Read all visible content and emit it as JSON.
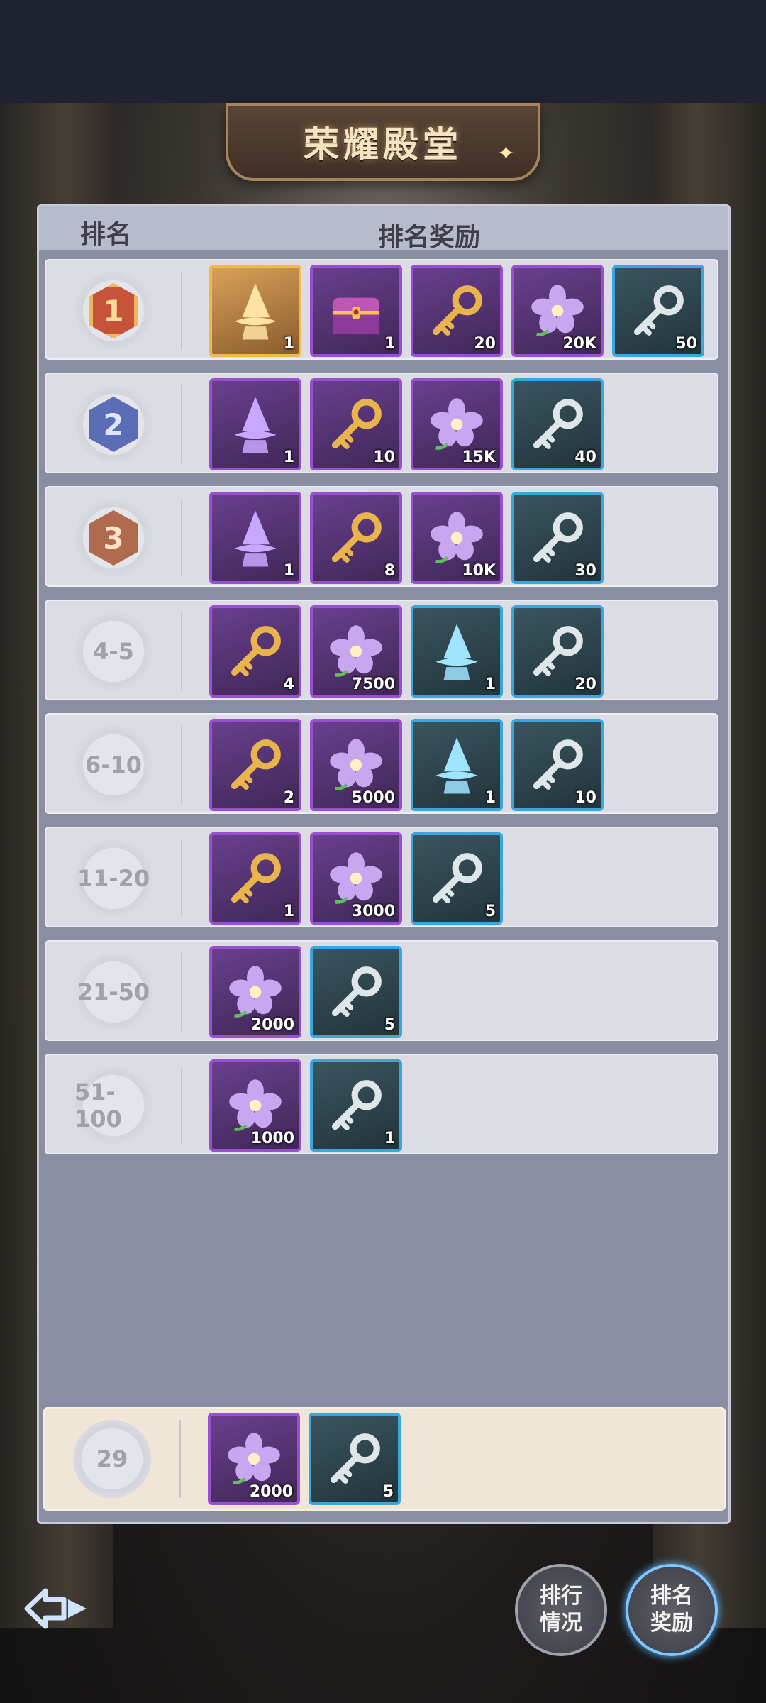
{
  "title": "荣耀殿堂",
  "header": {
    "rank": "排名",
    "reward": "排名奖励"
  },
  "rows": [
    {
      "rank": "1",
      "medal": "m1",
      "items": [
        {
          "icon": "wizard-hat-icon",
          "style": "gold",
          "qty": "1"
        },
        {
          "icon": "treasure-chest-icon",
          "style": "purple",
          "qty": "1"
        },
        {
          "icon": "gold-key-icon",
          "style": "purple",
          "qty": "20"
        },
        {
          "icon": "purple-flower-icon",
          "style": "purple",
          "qty": "20K"
        },
        {
          "icon": "silver-key-icon",
          "style": "blue",
          "qty": "50"
        }
      ]
    },
    {
      "rank": "2",
      "medal": "m2",
      "items": [
        {
          "icon": "wizard-hat-icon",
          "style": "purple",
          "qty": "1"
        },
        {
          "icon": "gold-key-icon",
          "style": "purple",
          "qty": "10"
        },
        {
          "icon": "purple-flower-icon",
          "style": "purple",
          "qty": "15K"
        },
        {
          "icon": "silver-key-icon",
          "style": "blue",
          "qty": "40"
        }
      ]
    },
    {
      "rank": "3",
      "medal": "m3",
      "items": [
        {
          "icon": "wizard-hat-icon",
          "style": "purple",
          "qty": "1"
        },
        {
          "icon": "gold-key-icon",
          "style": "purple",
          "qty": "8"
        },
        {
          "icon": "purple-flower-icon",
          "style": "purple",
          "qty": "10K"
        },
        {
          "icon": "silver-key-icon",
          "style": "blue",
          "qty": "30"
        }
      ]
    },
    {
      "rank": "4-5",
      "items": [
        {
          "icon": "gold-key-icon",
          "style": "purple",
          "qty": "4"
        },
        {
          "icon": "purple-flower-icon",
          "style": "purple",
          "qty": "7500"
        },
        {
          "icon": "wizard-hat-icon",
          "style": "blue",
          "qty": "1"
        },
        {
          "icon": "silver-key-icon",
          "style": "blue",
          "qty": "20"
        }
      ]
    },
    {
      "rank": "6-10",
      "items": [
        {
          "icon": "gold-key-icon",
          "style": "purple",
          "qty": "2"
        },
        {
          "icon": "purple-flower-icon",
          "style": "purple",
          "qty": "5000"
        },
        {
          "icon": "wizard-hat-icon",
          "style": "blue",
          "qty": "1"
        },
        {
          "icon": "silver-key-icon",
          "style": "blue",
          "qty": "10"
        }
      ]
    },
    {
      "rank": "11-20",
      "items": [
        {
          "icon": "gold-key-icon",
          "style": "purple",
          "qty": "1"
        },
        {
          "icon": "purple-flower-icon",
          "style": "purple",
          "qty": "3000"
        },
        {
          "icon": "silver-key-icon",
          "style": "blue",
          "qty": "5"
        }
      ]
    },
    {
      "rank": "21-50",
      "items": [
        {
          "icon": "purple-flower-icon",
          "style": "purple",
          "qty": "2000"
        },
        {
          "icon": "silver-key-icon",
          "style": "blue",
          "qty": "5"
        }
      ]
    },
    {
      "rank": "51-100",
      "items": [
        {
          "icon": "purple-flower-icon",
          "style": "purple",
          "qty": "1000"
        },
        {
          "icon": "silver-key-icon",
          "style": "blue",
          "qty": "1"
        }
      ]
    }
  ],
  "my_rank": {
    "rank": "29",
    "items": [
      {
        "icon": "purple-flower-icon",
        "style": "purple",
        "qty": "2000"
      },
      {
        "icon": "silver-key-icon",
        "style": "blue",
        "qty": "5"
      }
    ]
  },
  "buttons": {
    "ranking_status": "排行\n情况",
    "ranking_reward": "排名\n奖励"
  }
}
